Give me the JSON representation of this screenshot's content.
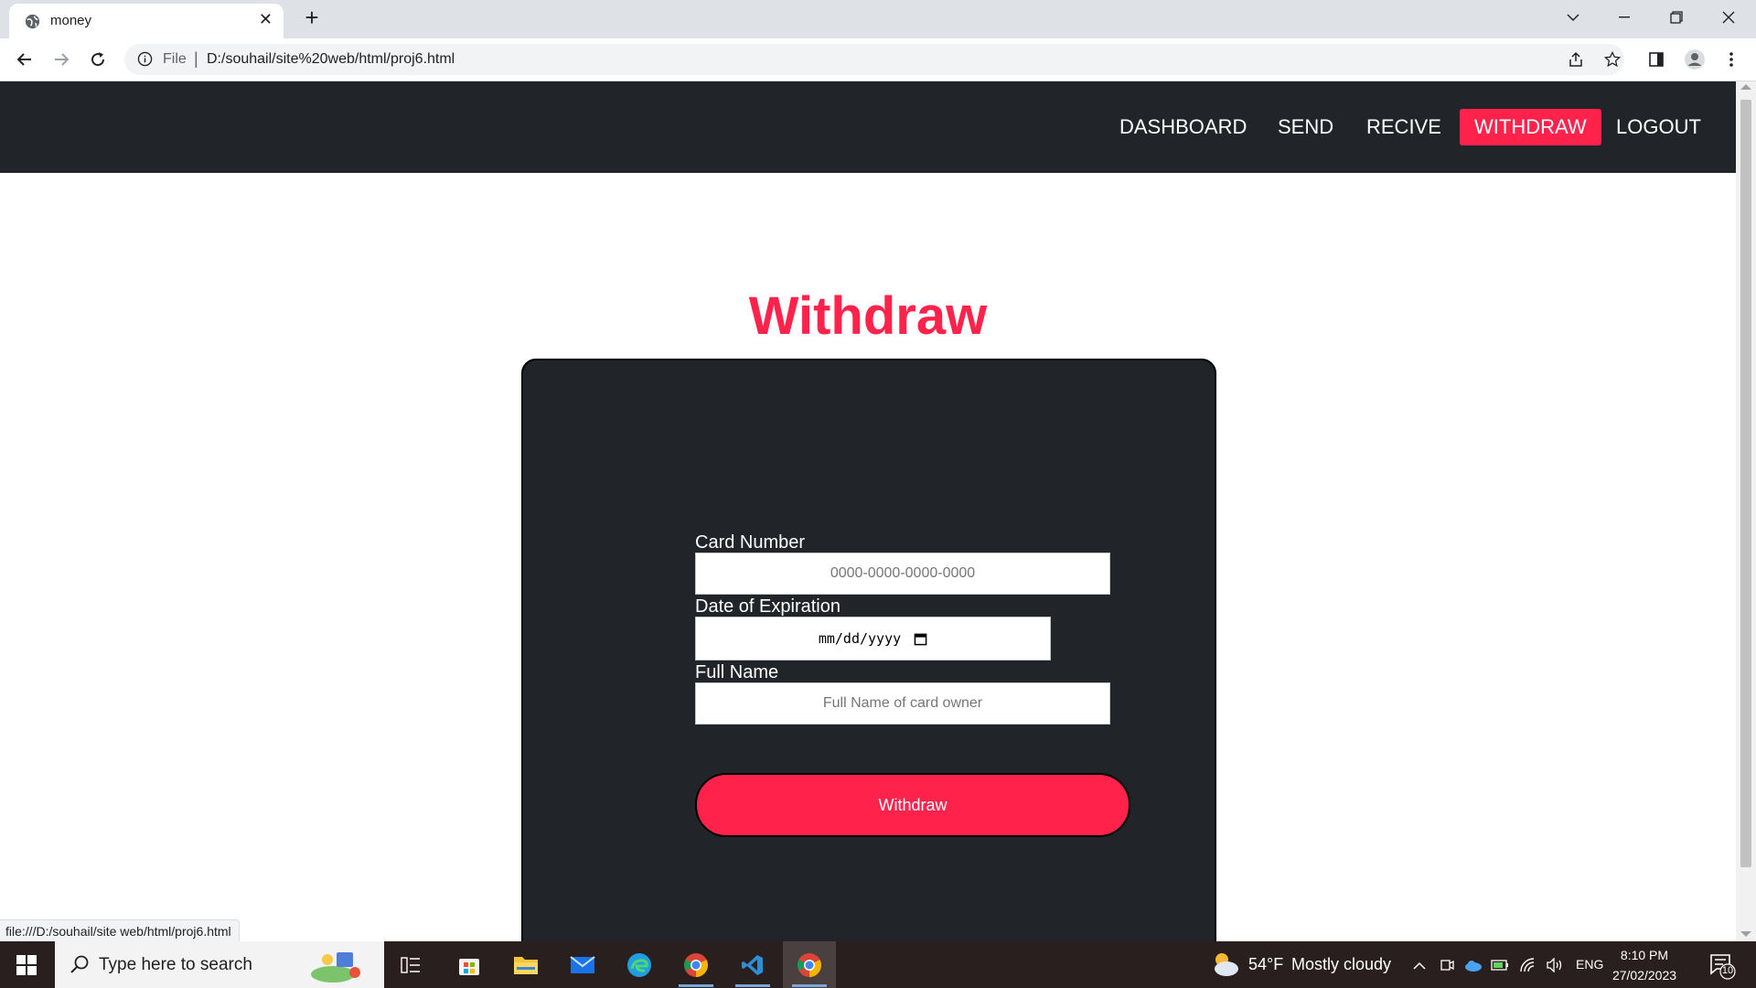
{
  "browser": {
    "tab": {
      "title": "money",
      "favicon": "globe-icon"
    },
    "address_bar": {
      "scheme_label": "File",
      "url": "D:/souhail/site%20web/html/proj6.html"
    },
    "status_url": "file:///D:/souhail/site web/html/proj6.html"
  },
  "navbar": {
    "links": [
      "DASHBOARD",
      "SEND",
      "RECIVE",
      "WITHDRAW",
      "LOGOUT"
    ],
    "active": "WITHDRAW"
  },
  "page": {
    "title": "Withdraw",
    "form": {
      "card_number": {
        "label": "Card Number",
        "placeholder": "0000-0000-0000-0000"
      },
      "expiration": {
        "label": "Date of Expiration",
        "placeholder": "mm/dd/yyyy"
      },
      "full_name": {
        "label": "Full Name",
        "placeholder": "Full Name of card owner"
      },
      "submit_label": "Withdraw"
    }
  },
  "taskbar": {
    "search_placeholder": "Type here to search",
    "weather": {
      "temp": "54°F",
      "condition": "Mostly cloudy"
    },
    "language": "ENG",
    "clock": {
      "time": "8:10 PM",
      "date": "27/02/2023"
    },
    "notification_count": "10",
    "apps": [
      "task-view",
      "microsoft-store",
      "file-explorer",
      "mail",
      "edge",
      "chrome",
      "vscode",
      "chrome-active"
    ]
  },
  "colors": {
    "accent": "#ff234c",
    "navbar_bg": "#212529",
    "card_bg": "#212529",
    "taskbar_bg": "#2a1f1f"
  }
}
